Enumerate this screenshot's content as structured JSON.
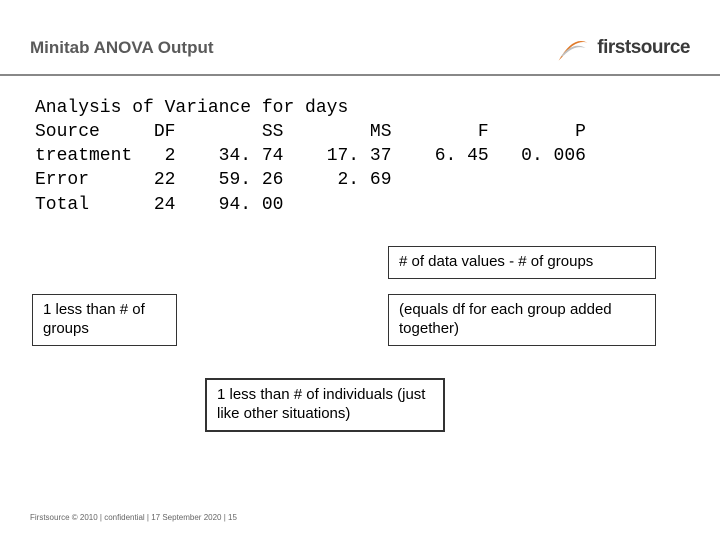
{
  "slide": {
    "title": "Minitab ANOVA Output",
    "logo_text": "firstsource"
  },
  "anova": {
    "heading": "Analysis of Variance for days",
    "columns": [
      "Source",
      "DF",
      "SS",
      "MS",
      "F",
      "P"
    ],
    "rows": [
      {
        "source": "treatment",
        "df": "2",
        "ss": "34. 74",
        "ms": "17. 37",
        "f": "6. 45",
        "p": "0. 006"
      },
      {
        "source": "Error",
        "df": "22",
        "ss": "59. 26",
        "ms": "2. 69",
        "f": "",
        "p": ""
      },
      {
        "source": "Total",
        "df": "24",
        "ss": "94. 00",
        "ms": "",
        "f": "",
        "p": ""
      }
    ]
  },
  "annotations": {
    "a1": "# of data values - # of groups",
    "a2a": "1 less than # of groups",
    "a2b": "(equals df for each group added together)",
    "a3": "1 less than # of individuals (just like other situations)"
  },
  "footer": "Firstsource © 2010 | confidential | 17 September 2020 | 15",
  "chart_data": {
    "type": "table",
    "title": "Analysis of Variance for days",
    "columns": [
      "Source",
      "DF",
      "SS",
      "MS",
      "F",
      "P"
    ],
    "rows": [
      [
        "treatment",
        2,
        34.74,
        17.37,
        6.45,
        0.006
      ],
      [
        "Error",
        22,
        59.26,
        2.69,
        null,
        null
      ],
      [
        "Total",
        24,
        94.0,
        null,
        null,
        null
      ]
    ]
  }
}
